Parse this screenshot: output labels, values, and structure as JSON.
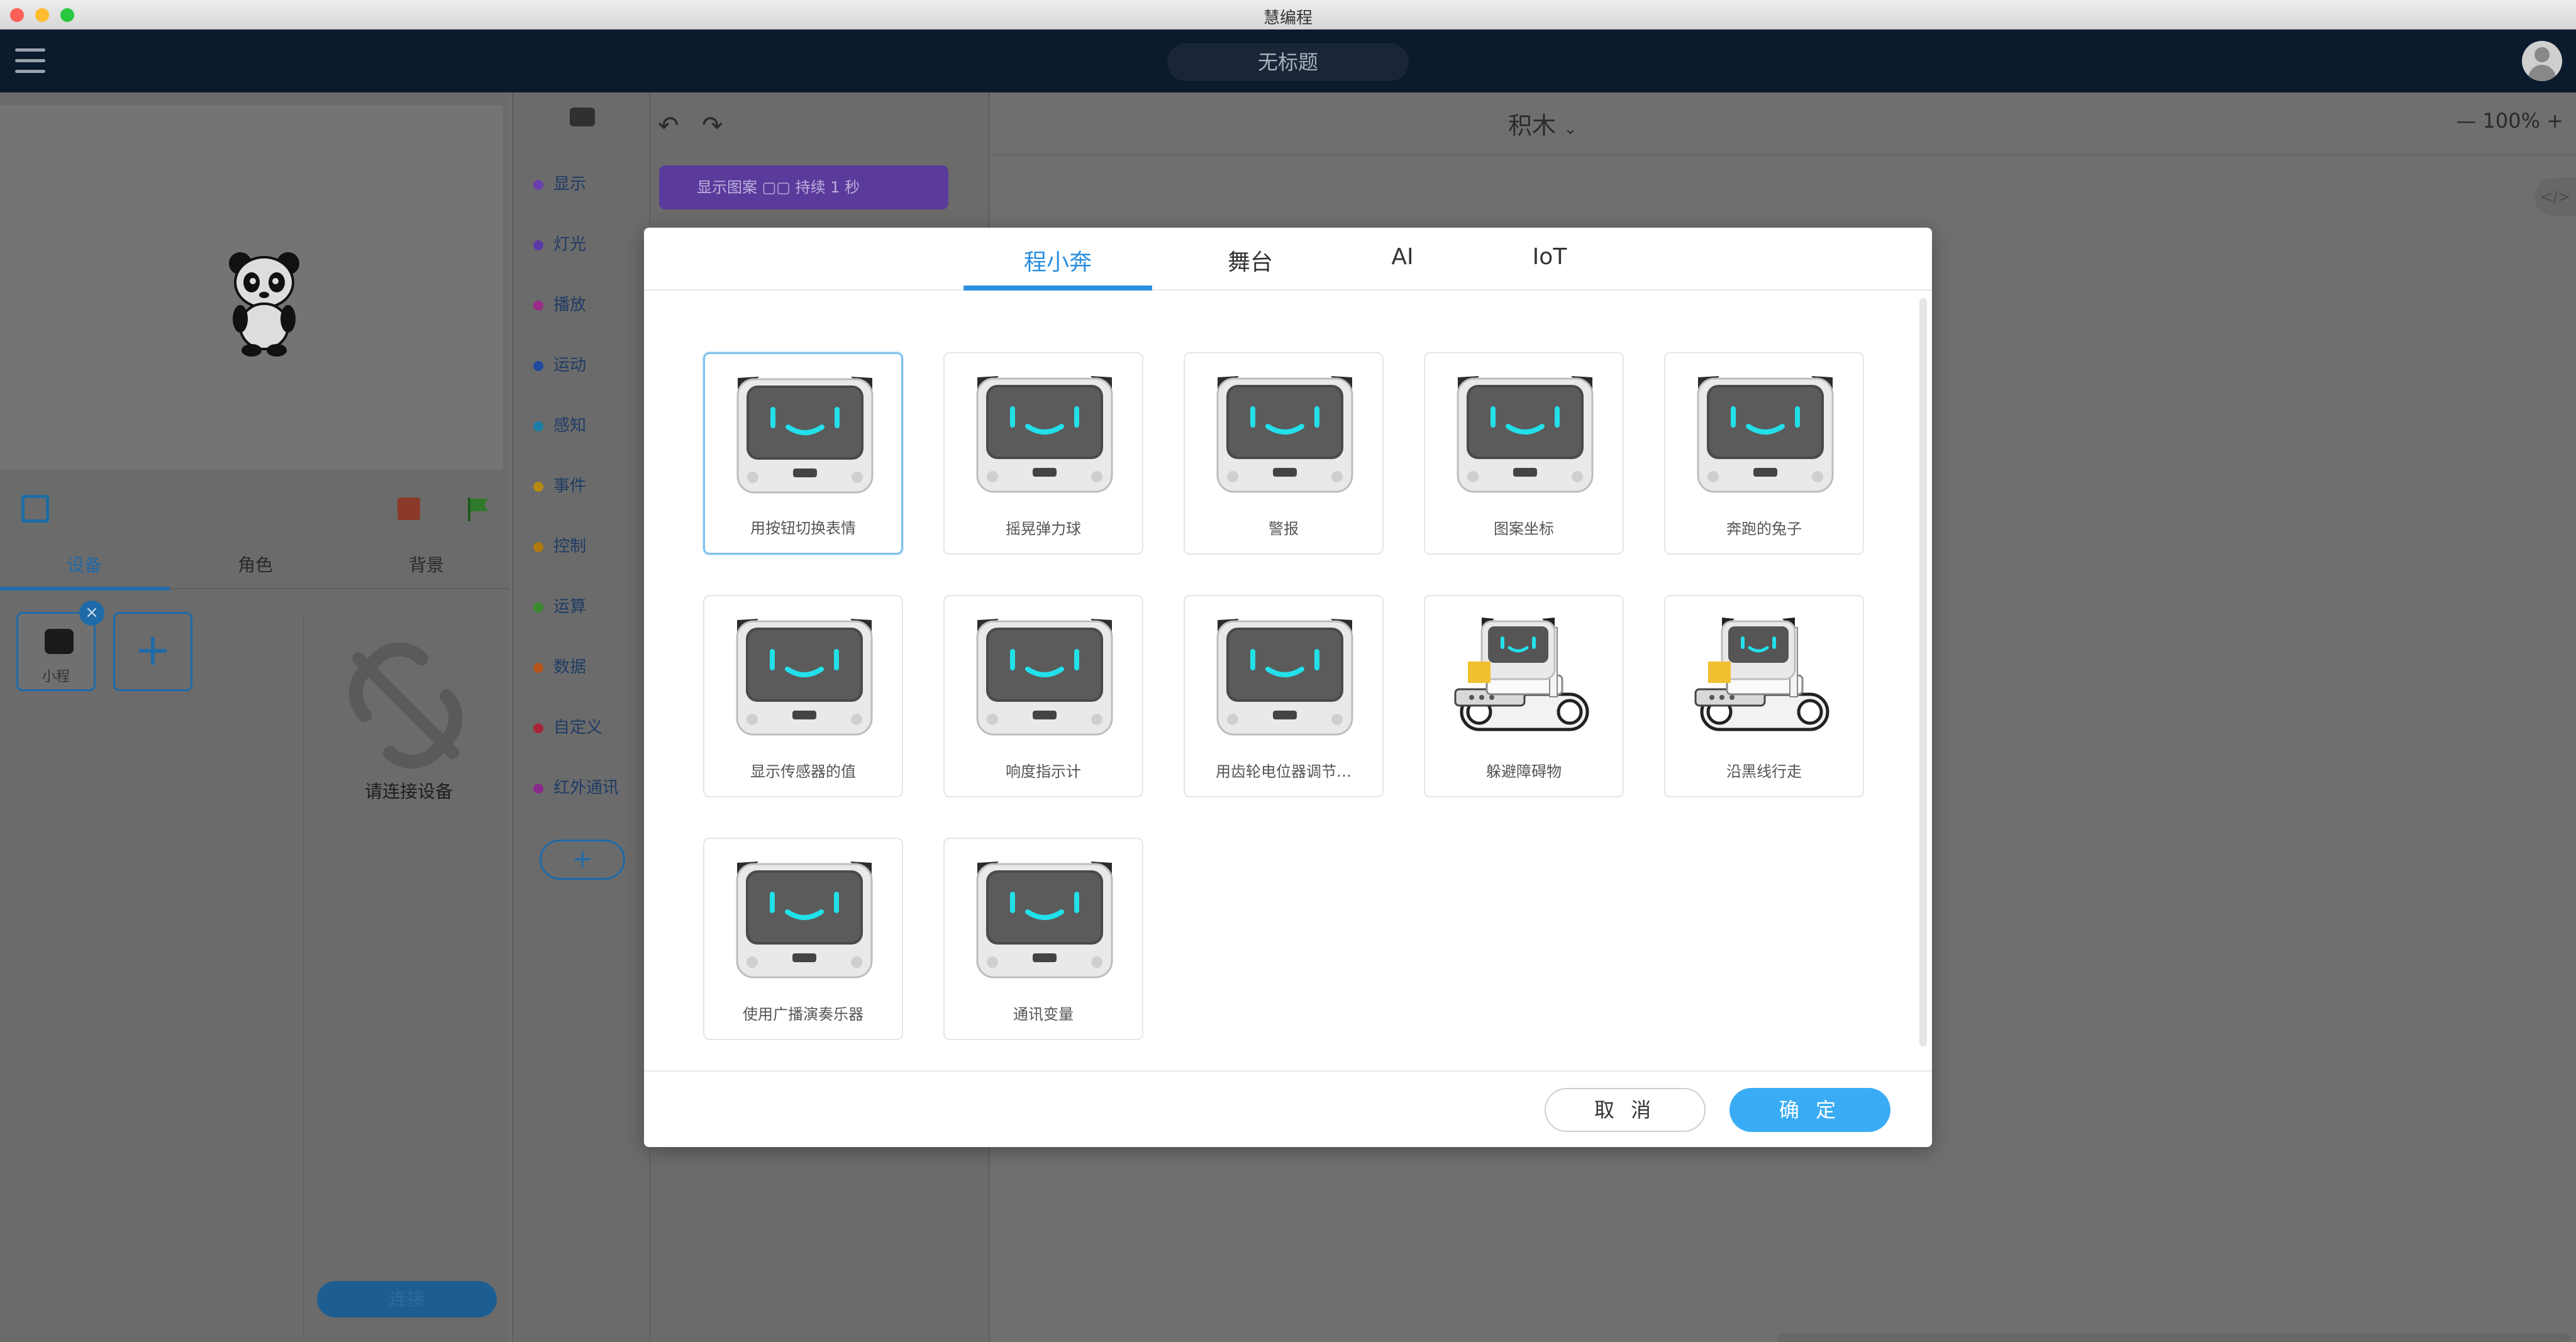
{
  "window": {
    "title": "慧编程"
  },
  "header": {
    "project_title": "无标题"
  },
  "left_panel": {
    "tabs": [
      "设备",
      "角色",
      "背景"
    ],
    "device_label": "小程",
    "connect_hint": "请连接设备",
    "connect_button": "连接"
  },
  "categories": [
    {
      "label": "显示",
      "color": "#6a3fb0"
    },
    {
      "label": "灯光",
      "color": "#5b3aa8"
    },
    {
      "label": "播放",
      "color": "#9b2c8a"
    },
    {
      "label": "运动",
      "color": "#1f4aa0"
    },
    {
      "label": "感知",
      "color": "#1b7ea6"
    },
    {
      "label": "事件",
      "color": "#b58a12"
    },
    {
      "label": "控制",
      "color": "#b07a10"
    },
    {
      "label": "运算",
      "color": "#3a8a2e"
    },
    {
      "label": "数据",
      "color": "#b4541a"
    },
    {
      "label": "自定义",
      "color": "#a8243a"
    },
    {
      "label": "红外通讯",
      "color": "#8a2a8a"
    }
  ],
  "blocks": {
    "first_block": "显示图案 ▢▢ 持续 1 秒"
  },
  "workspace": {
    "mode": "积木",
    "zoom": "100%",
    "zoom_minus": "—",
    "zoom_plus": "+",
    "code_toggle": "</>"
  },
  "modal": {
    "tabs": [
      "程小奔",
      "舞台",
      "AI",
      "IoT"
    ],
    "examples": [
      {
        "label": "用按钮切换表情",
        "kind": "face",
        "selected": true
      },
      {
        "label": "摇晃弹力球",
        "kind": "face"
      },
      {
        "label": "警报",
        "kind": "face"
      },
      {
        "label": "图案坐标",
        "kind": "face"
      },
      {
        "label": "奔跑的兔子",
        "kind": "face"
      },
      {
        "label": "显示传感器的值",
        "kind": "face"
      },
      {
        "label": "响度指示计",
        "kind": "face"
      },
      {
        "label": "用齿轮电位器调节…",
        "kind": "face"
      },
      {
        "label": "躲避障碍物",
        "kind": "tank"
      },
      {
        "label": "沿黑线行走",
        "kind": "tank"
      },
      {
        "label": "使用广播演奏乐器",
        "kind": "face"
      },
      {
        "label": "通讯变量",
        "kind": "face"
      }
    ],
    "cancel": "取 消",
    "confirm": "确 定"
  }
}
